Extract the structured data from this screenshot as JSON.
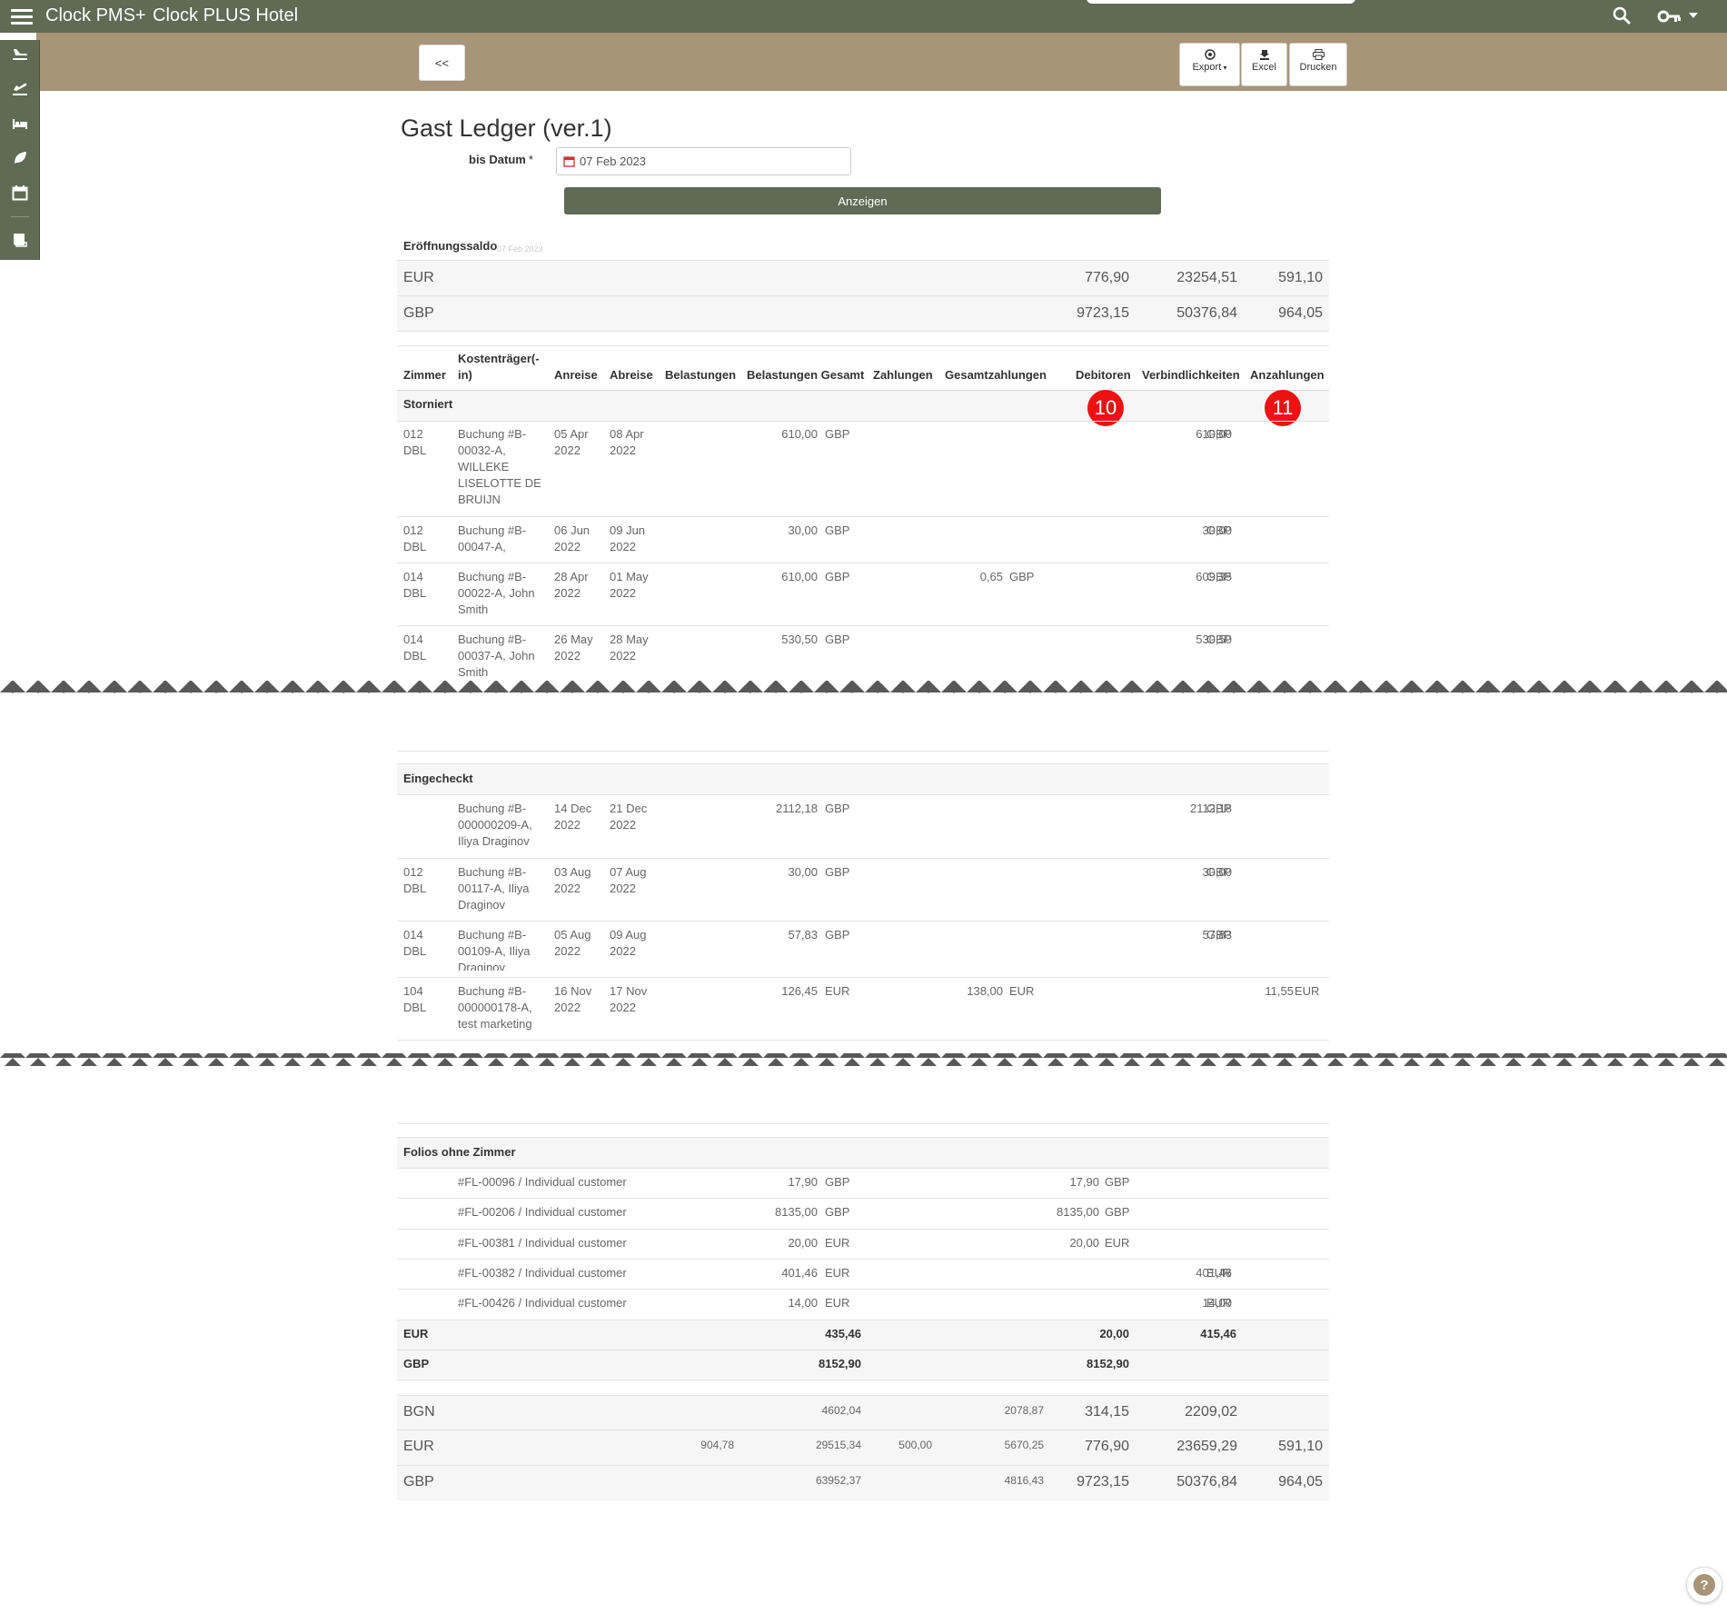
{
  "app": {
    "brand": "Clock PMS+",
    "hotel": "Clock PLUS Hotel"
  },
  "toolbar": {
    "back_label": "<<",
    "export_label": "Export",
    "excel_label": "Excel",
    "print_label": "Drucken"
  },
  "page": {
    "title": "Gast Ledger (ver.1)",
    "date_label": "bis Datum",
    "date_required": "*",
    "date_value": "07 Feb 2023",
    "show_button": "Anzeigen"
  },
  "opening_balance": {
    "label": "Eröffnungssaldo",
    "date": "07 Feb 2023",
    "rows": [
      {
        "currency": "EUR",
        "debitoren": "776,90",
        "verbindlichkeiten": "23254,51",
        "anzahlungen": "591,10"
      },
      {
        "currency": "GBP",
        "debitoren": "9723,15",
        "verbindlichkeiten": "50376,84",
        "anzahlungen": "964,05"
      }
    ]
  },
  "columns": {
    "zimmer": "Zimmer",
    "kostentraeger_1": "Kostenträger(-",
    "kostentraeger_2": "in)",
    "anreise": "Anreise",
    "abreise": "Abreise",
    "belastungen": "Belastungen",
    "belastungen_gesamt": "Belastungen Gesamt",
    "zahlungen": "Zahlungen",
    "gesamtzahlungen": "Gesamtzahlungen",
    "debitoren": "Debitoren",
    "verbindlichkeiten": "Verbindlichkeiten",
    "anzahlungen": "Anzahlungen"
  },
  "markers": {
    "m10": "10",
    "m11": "11"
  },
  "storniert": {
    "label": "Storniert",
    "rows": [
      {
        "room": [
          "012",
          "DBL"
        ],
        "payer": [
          "Buchung #B-",
          "00032-A,",
          "WILLEKE",
          "LISELOTTE DE",
          "BRUIJN"
        ],
        "arr": [
          "05 Apr",
          "2022"
        ],
        "dep": [
          "08 Apr",
          "2022"
        ],
        "bel_gesamt": "610,00",
        "bel_cur": "GBP",
        "verb": "610,00",
        "verb_cur": "GBP"
      },
      {
        "room": [
          "012",
          "DBL"
        ],
        "payer": [
          "Buchung #B-",
          "00047-A,"
        ],
        "arr": [
          "06 Jun",
          "2022"
        ],
        "dep": [
          "09 Jun",
          "2022"
        ],
        "bel_gesamt": "30,00",
        "bel_cur": "GBP",
        "verb": "30,00",
        "verb_cur": "GBP"
      },
      {
        "room": [
          "014",
          "DBL"
        ],
        "payer": [
          "Buchung #B-",
          "00022-A, John",
          "Smith"
        ],
        "arr": [
          "28 Apr",
          "2022"
        ],
        "dep": [
          "01 May",
          "2022"
        ],
        "bel_gesamt": "610,00",
        "bel_cur": "GBP",
        "gz": "0,65",
        "gz_cur": "GBP",
        "verb": "609,35",
        "verb_cur": "GBP"
      },
      {
        "room": [
          "014",
          "DBL"
        ],
        "payer": [
          "Buchung #B-",
          "00037-A, John",
          "Smith"
        ],
        "arr": [
          "26 May",
          "2022"
        ],
        "dep": [
          "28 May",
          "2022"
        ],
        "bel_gesamt": "530,50",
        "bel_cur": "GBP",
        "verb": "530,50",
        "verb_cur": "GBP"
      }
    ]
  },
  "eingecheckt": {
    "label": "Eingecheckt",
    "rows": [
      {
        "room": [
          "",
          ""
        ],
        "payer": [
          "Buchung #B-",
          "000000209-A,",
          "Iliya Draginov"
        ],
        "arr": [
          "14 Dec",
          "2022"
        ],
        "dep": [
          "21 Dec",
          "2022"
        ],
        "bel_gesamt": "2112,18",
        "bel_cur": "GBP",
        "verb": "2112,18",
        "verb_cur": "GBP"
      },
      {
        "room": [
          "012",
          "DBL"
        ],
        "payer": [
          "Buchung #B-",
          "00117-A, Iliya",
          "Draginov"
        ],
        "arr": [
          "03 Aug",
          "2022"
        ],
        "dep": [
          "07 Aug",
          "2022"
        ],
        "bel_gesamt": "30,00",
        "bel_cur": "GBP",
        "verb": "30,00",
        "verb_cur": "GBP"
      },
      {
        "room": [
          "014",
          "DBL"
        ],
        "payer": [
          "Buchung #B-",
          "00109-A, Iliya",
          "Draginov"
        ],
        "arr": [
          "05 Aug",
          "2022"
        ],
        "dep": [
          "09 Aug",
          "2022"
        ],
        "bel_gesamt": "57,83",
        "bel_cur": "GBP",
        "verb": "57,83",
        "verb_cur": "GBP"
      },
      {
        "room": [
          "104",
          "DBL"
        ],
        "payer": [
          "Buchung #B-",
          "000000178-A,",
          "test marketing"
        ],
        "arr": [
          "16 Nov",
          "2022"
        ],
        "dep": [
          "17 Nov",
          "2022"
        ],
        "bel_gesamt": "126,45",
        "bel_cur": "EUR",
        "gz": "138,00",
        "gz_cur": "EUR",
        "anz": "11,55",
        "anz_cur": "EUR"
      }
    ]
  },
  "folios": {
    "label": "Folios ohne Zimmer",
    "rows": [
      {
        "name": "#FL-00096 / Individual customer",
        "bel_gesamt": "17,90",
        "bel_cur": "GBP",
        "deb": "17,90",
        "deb_cur": "GBP"
      },
      {
        "name": "#FL-00206 / Individual customer",
        "bel_gesamt": "8135,00",
        "bel_cur": "GBP",
        "deb": "8135,00",
        "deb_cur": "GBP"
      },
      {
        "name": "#FL-00381 / Individual customer",
        "bel_gesamt": "20,00",
        "bel_cur": "EUR",
        "deb": "20,00",
        "deb_cur": "EUR"
      },
      {
        "name": "#FL-00382 / Individual customer",
        "bel_gesamt": "401,46",
        "bel_cur": "EUR",
        "verb": "401,46",
        "verb_cur": "EUR"
      },
      {
        "name": "#FL-00426 / Individual customer",
        "bel_gesamt": "14,00",
        "bel_cur": "EUR",
        "verb": "14,00",
        "verb_cur": "EUR"
      }
    ],
    "subtotals": [
      {
        "currency": "EUR",
        "bel_gesamt": "435,46",
        "deb": "20,00",
        "verb": "415,46"
      },
      {
        "currency": "GBP",
        "bel_gesamt": "8152,90",
        "deb": "8152,90"
      }
    ]
  },
  "totals": [
    {
      "currency": "BGN",
      "bel_gesamt": "4602,04",
      "gz": "2078,87",
      "deb": "314,15",
      "verb": "2209,02"
    },
    {
      "currency": "EUR",
      "bel": "904,78",
      "bel_gesamt": "29515,34",
      "zahl": "500,00",
      "gz": "5670,25",
      "deb": "776,90",
      "verb": "23659,29",
      "anz": "591,10"
    },
    {
      "currency": "GBP",
      "bel_gesamt": "63952,37",
      "gz": "4816,43",
      "deb": "9723,15",
      "verb": "50376,84",
      "anz": "964,05"
    }
  ]
}
